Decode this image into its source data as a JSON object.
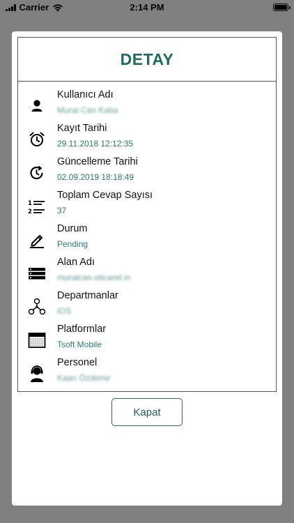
{
  "status_bar": {
    "carrier": "Carrier",
    "time": "2:14 PM"
  },
  "modal": {
    "title": "DETAY",
    "close_label": "Kapat",
    "accent_color": "#1f6b63",
    "rows": [
      {
        "icon": "user-icon",
        "label": "Kullanıcı Adı",
        "value": "Murat Can Kaba",
        "blurred": true
      },
      {
        "icon": "alarm-clock-icon",
        "label": "Kayıt Tarihi",
        "value": "29.11.2018 12:12:35",
        "blurred": false
      },
      {
        "icon": "history-clock-icon",
        "label": "Güncelleme Tarihi",
        "value": "02.09.2019 18:18:49",
        "blurred": false
      },
      {
        "icon": "numbered-list-icon",
        "label": "Toplam Cevap Sayısı",
        "value": "37",
        "blurred": false
      },
      {
        "icon": "pencil-icon",
        "label": "Durum",
        "value": "Pending",
        "blurred": false
      },
      {
        "icon": "server-icon",
        "label": "Alan Adı",
        "value": "muratcan.eticaret.in",
        "blurred": true
      },
      {
        "icon": "hierarchy-icon",
        "label": "Departmanlar",
        "value": "iOS",
        "blurred": true
      },
      {
        "icon": "stack-icon",
        "label": "Platformlar",
        "value": "Tsoft Mobile",
        "blurred": false
      },
      {
        "icon": "headset-agent-icon",
        "label": "Personel",
        "value": "Kaan Özdemir",
        "blurred": true
      }
    ]
  }
}
